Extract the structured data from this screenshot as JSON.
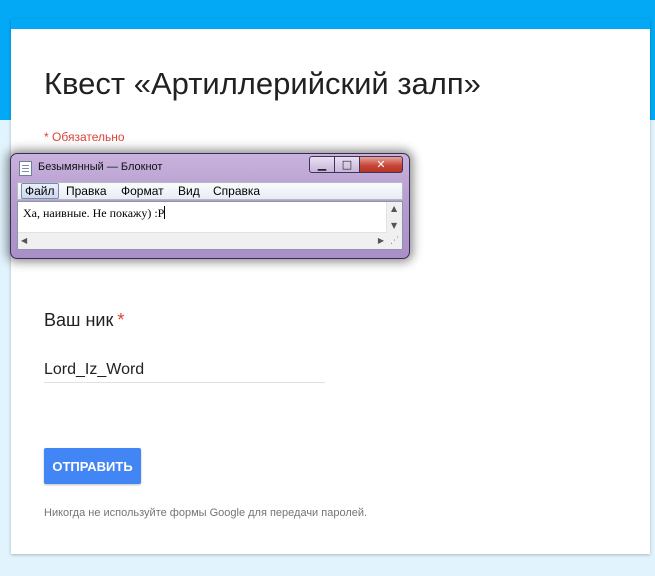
{
  "form": {
    "title": "Квест «Артиллерийский залп»",
    "required_note": "* Обязательно",
    "question_label": "Ваш ник",
    "required_star": "*",
    "answer_value": "Lord_Iz_Word",
    "submit_label": "ОТПРАВИТЬ",
    "footer_note": "Никогда не используйте формы Google для передачи паролей."
  },
  "notepad": {
    "title": "Безымянный — Блокнот",
    "menu": [
      "Файл",
      "Правка",
      "Формат",
      "Вид",
      "Справка"
    ],
    "text": "Ха, наивные. Не покажу) :P",
    "controls": {
      "minimize": "▁",
      "maximize": "□",
      "close": "✕"
    }
  },
  "colors": {
    "header": "#03a9f4",
    "background": "#e1f3fd",
    "required": "#db4437",
    "submit": "#4285f4"
  },
  "icons": {
    "app": "notepad-icon",
    "scroll_up": "▲",
    "scroll_down": "▼",
    "scroll_left": "◀",
    "scroll_right": "▶",
    "grip": "⋰"
  }
}
